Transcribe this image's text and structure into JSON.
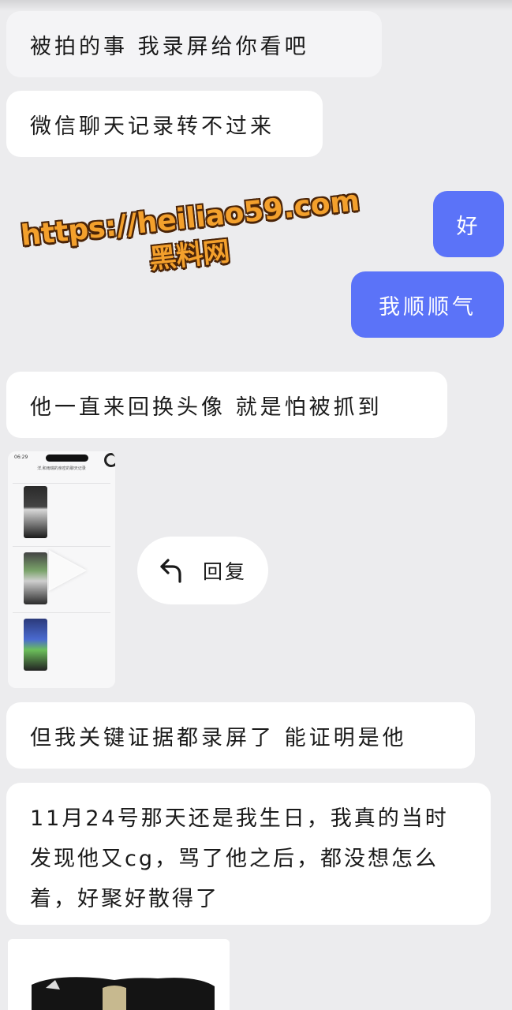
{
  "messages": [
    {
      "text": "被拍的事  我录屏给你看吧",
      "side": "incoming"
    },
    {
      "text": "微信聊天记录转不过来",
      "side": "incoming"
    },
    {
      "text": "好",
      "side": "outgoing"
    },
    {
      "text": "我顺顺气",
      "side": "outgoing"
    },
    {
      "text": "他一直来回换头像  就是怕被抓到",
      "side": "incoming"
    },
    {
      "text": "但我关键证据都录屏了  能证明是他",
      "side": "incoming"
    },
    {
      "text": "11月24号那天还是我生日，我真的当时发现他又cg，骂了他之后，都没想怎么着，好聚好散得了",
      "side": "incoming"
    }
  ],
  "video_preview": {
    "status_time": "06:29",
    "chat_title": "洋,和雨瑞的亲密的聊天记录",
    "play_icon": "play-icon"
  },
  "reply_button": {
    "label": "回复",
    "icon": "reply-arrow-icon"
  },
  "watermark": {
    "url": "https://heiliao59.com",
    "name": "黑料网"
  },
  "colors": {
    "background": "#ececee",
    "incoming_bubble": "#ffffff",
    "outgoing_bubble": "#5b73f8",
    "watermark_fill": "#f3a02c",
    "watermark_outline": "#4a2408"
  }
}
